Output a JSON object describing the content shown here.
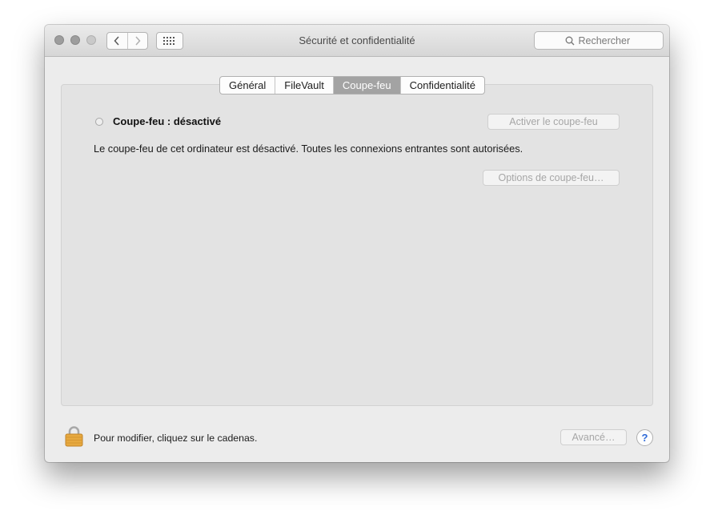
{
  "window": {
    "title": "Sécurité et confidentialité"
  },
  "search": {
    "placeholder": "Rechercher"
  },
  "tabs": [
    {
      "label": "Général",
      "active": false
    },
    {
      "label": "FileVault",
      "active": false
    },
    {
      "label": "Coupe-feu",
      "active": true
    },
    {
      "label": "Confidentialité",
      "active": false
    }
  ],
  "firewall": {
    "status_label": "Coupe-feu : désactivé",
    "description": "Le coupe-feu de cet ordinateur est désactivé. Toutes les connexions entrantes sont autorisées.",
    "activate_button": "Activer le coupe-feu",
    "options_button": "Options de coupe-feu…"
  },
  "footer": {
    "lock_text": "Pour modifier, cliquez sur le cadenas.",
    "advanced_button": "Avancé…",
    "help_button": "?"
  },
  "icons": {
    "back": "chevron-left-icon",
    "forward": "chevron-right-icon",
    "grid": "grid-icon",
    "search": "search-icon",
    "lock": "lock-icon",
    "status": "status-indicator-icon"
  },
  "colors": {
    "active_tab": "#a3a3a3",
    "lock": "#e7a93f",
    "help": "#2f6bd8"
  }
}
